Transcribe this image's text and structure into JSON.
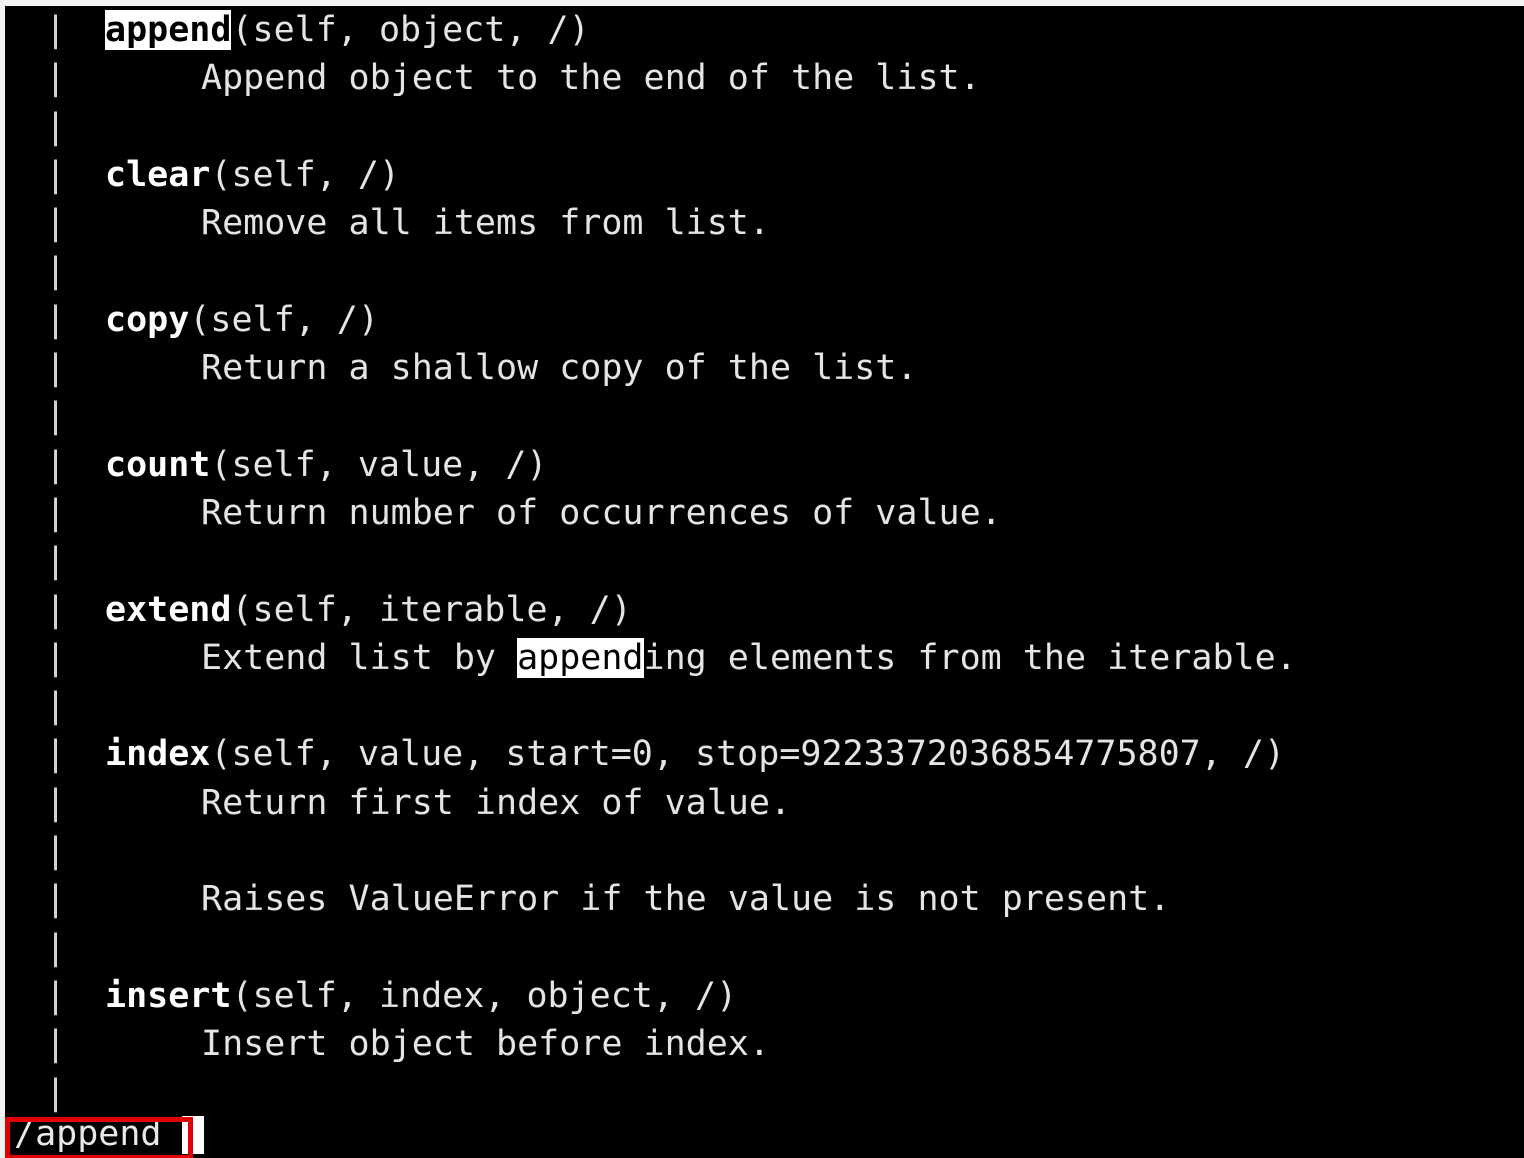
{
  "terminal": {
    "app": "terminal-pager",
    "content_description": "Python help() output for list methods shown in the less pager",
    "gutter_char": "|",
    "colors": {
      "background": "#000000",
      "foreground": "#e8e8e8",
      "gutter": "#d4d4d4",
      "match_background": "#ffffff",
      "match_foreground": "#000000",
      "annotation": "#e00000",
      "window_frame": "#f2f2f0"
    },
    "search_term": "append",
    "lines": [
      {
        "type": "signature",
        "name": "append",
        "name_highlight": true,
        "rest": "(self, object, /)"
      },
      {
        "type": "description",
        "text": "Append object to the end of the list."
      },
      {
        "type": "blank",
        "text": ""
      },
      {
        "type": "signature",
        "name": "clear",
        "name_highlight": false,
        "rest": "(self, /)"
      },
      {
        "type": "description",
        "text": "Remove all items from list."
      },
      {
        "type": "blank",
        "text": ""
      },
      {
        "type": "signature",
        "name": "copy",
        "name_highlight": false,
        "rest": "(self, /)"
      },
      {
        "type": "description",
        "text": "Return a shallow copy of the list."
      },
      {
        "type": "blank",
        "text": ""
      },
      {
        "type": "signature",
        "name": "count",
        "name_highlight": false,
        "rest": "(self, value, /)"
      },
      {
        "type": "description",
        "text": "Return number of occurrences of value."
      },
      {
        "type": "blank",
        "text": ""
      },
      {
        "type": "signature",
        "name": "extend",
        "name_highlight": false,
        "rest": "(self, iterable, /)"
      },
      {
        "type": "description_match",
        "before": "Extend list by ",
        "match": "append",
        "after": "ing elements from the iterable."
      },
      {
        "type": "blank",
        "text": ""
      },
      {
        "type": "signature",
        "name": "index",
        "name_highlight": false,
        "rest": "(self, value, start=0, stop=9223372036854775807, /)"
      },
      {
        "type": "description",
        "text": "Return first index of value."
      },
      {
        "type": "blank",
        "text": ""
      },
      {
        "type": "description",
        "text": "Raises ValueError if the value is not present."
      },
      {
        "type": "blank",
        "text": ""
      },
      {
        "type": "signature",
        "name": "insert",
        "name_highlight": false,
        "rest": "(self, index, object, /)"
      },
      {
        "type": "description",
        "text": "Insert object before index."
      },
      {
        "type": "blank",
        "text": ""
      }
    ],
    "prompt": {
      "label": "/append",
      "command_char": "/",
      "query": "append",
      "cursor_visible": true
    },
    "annotation": {
      "shape": "rectangle",
      "color": "#e00000",
      "targets": "prompt-line"
    }
  }
}
